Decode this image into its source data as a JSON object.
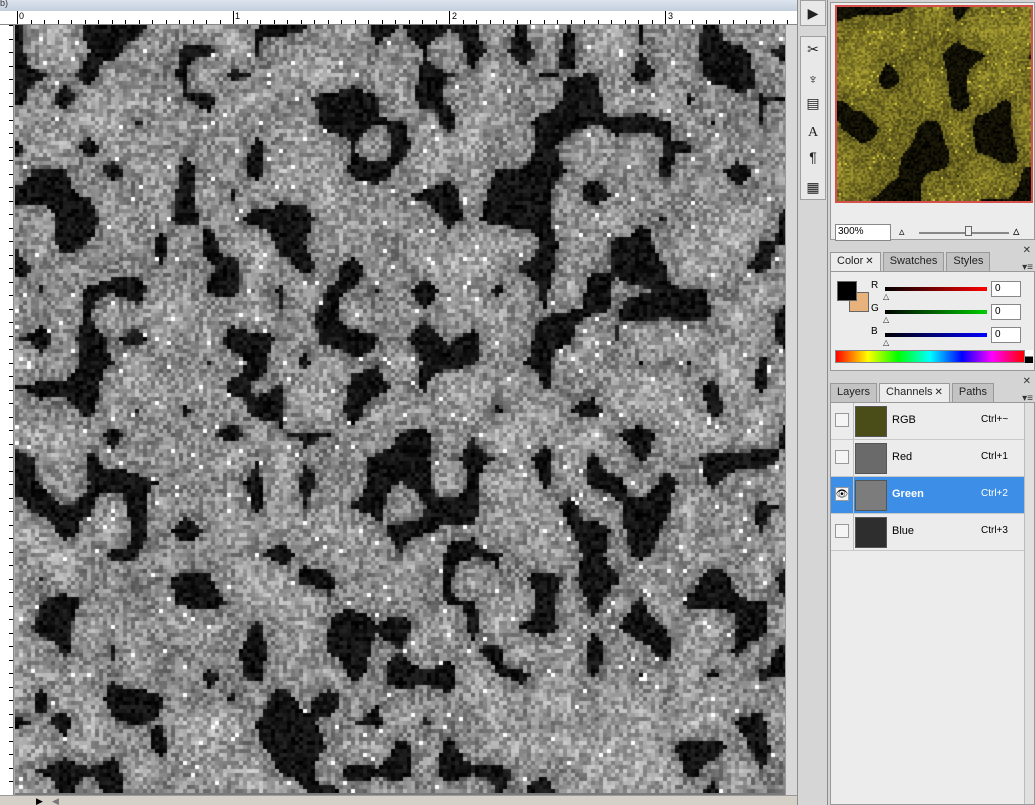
{
  "document": {
    "title_fragment": "b)",
    "ruler_labels": [
      "0",
      "1",
      "2",
      "3"
    ],
    "ruler_left_label": "0"
  },
  "dock": {
    "buttons": [
      {
        "name": "play-action-icon",
        "glyph": "▶"
      },
      {
        "name": "tools-icon",
        "glyph": "✂"
      },
      {
        "name": "clone-source-icon",
        "glyph": "♆"
      },
      {
        "name": "brushes-icon",
        "glyph": "▤"
      },
      {
        "name": "character-icon",
        "glyph": "A"
      },
      {
        "name": "paragraph-icon",
        "glyph": "¶"
      },
      {
        "name": "layer-comps-icon",
        "glyph": "▦"
      }
    ]
  },
  "navigator": {
    "zoom_value": "300%"
  },
  "color_panel": {
    "tabs": [
      {
        "label": "Color",
        "active": true,
        "closable": true
      },
      {
        "label": "Swatches",
        "active": false,
        "closable": false
      },
      {
        "label": "Styles",
        "active": false,
        "closable": false
      }
    ],
    "foreground_color": "#000000",
    "background_color": "#e8b27d",
    "sliders": [
      {
        "label": "R",
        "value": "0",
        "gradient_end": "#ff0000"
      },
      {
        "label": "G",
        "value": "0",
        "gradient_end": "#00cc00"
      },
      {
        "label": "B",
        "value": "0",
        "gradient_end": "#0000ff"
      }
    ]
  },
  "channels_panel": {
    "tabs": [
      {
        "label": "Layers",
        "active": false,
        "closable": false
      },
      {
        "label": "Channels",
        "active": true,
        "closable": true
      },
      {
        "label": "Paths",
        "active": false,
        "closable": false
      }
    ],
    "channels": [
      {
        "name": "RGB",
        "shortcut": "Ctrl+~",
        "visible": false,
        "selected": false,
        "thumb_color": "#4a4d18"
      },
      {
        "name": "Red",
        "shortcut": "Ctrl+1",
        "visible": false,
        "selected": false,
        "thumb_color": "#6a6a6a"
      },
      {
        "name": "Green",
        "shortcut": "Ctrl+2",
        "visible": true,
        "selected": true,
        "thumb_color": "#7c7c7c"
      },
      {
        "name": "Blue",
        "shortcut": "Ctrl+3",
        "visible": false,
        "selected": false,
        "thumb_color": "#2e2e2e"
      }
    ]
  },
  "colors": {
    "selection": "#3d8ee6",
    "navigator_frame": "#d4504a"
  }
}
